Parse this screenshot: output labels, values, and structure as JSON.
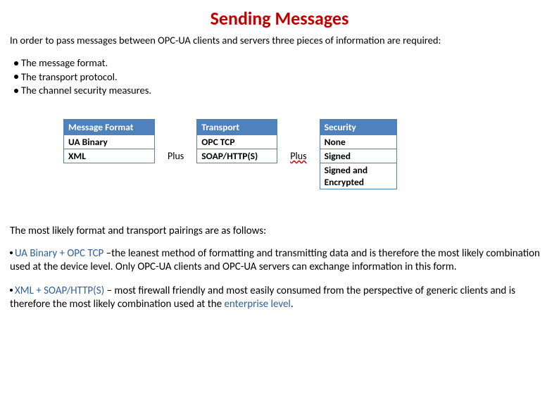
{
  "title": "Sending Messages",
  "intro": "In order to pass messages between OPC-UA clients and servers three pieces of information are required:",
  "bullets": [
    "The message format.",
    "The transport protocol.",
    "The channel security measures."
  ],
  "tables": {
    "message_format": {
      "header": "Message Format",
      "rows": [
        "UA Binary",
        "XML"
      ]
    },
    "transport": {
      "header": "Transport",
      "rows": [
        "OPC TCP",
        "SOAP/HTTP(S)"
      ]
    },
    "security": {
      "header": "Security",
      "rows": [
        "None",
        "Signed",
        "Signed and Encrypted"
      ]
    }
  },
  "plus_label": "Plus",
  "section_intro": "The most likely format and transport pairings are as follows:",
  "pair1": {
    "lead": "UA Binary + OPC TCP",
    "rest": " –the leanest method of formatting and transmitting data and is therefore the most likely combination used at the device level. Only OPC-UA clients and OPC-UA servers can exchange information in this form."
  },
  "pair2": {
    "lead": "XML + SOAP/HTTP(S)",
    "mid": " –  most firewall friendly and most easily consumed from the perspective of generic clients and is therefore the most likely combination used at the ",
    "tail_hl": "enterprise level",
    "tail_end": "."
  }
}
